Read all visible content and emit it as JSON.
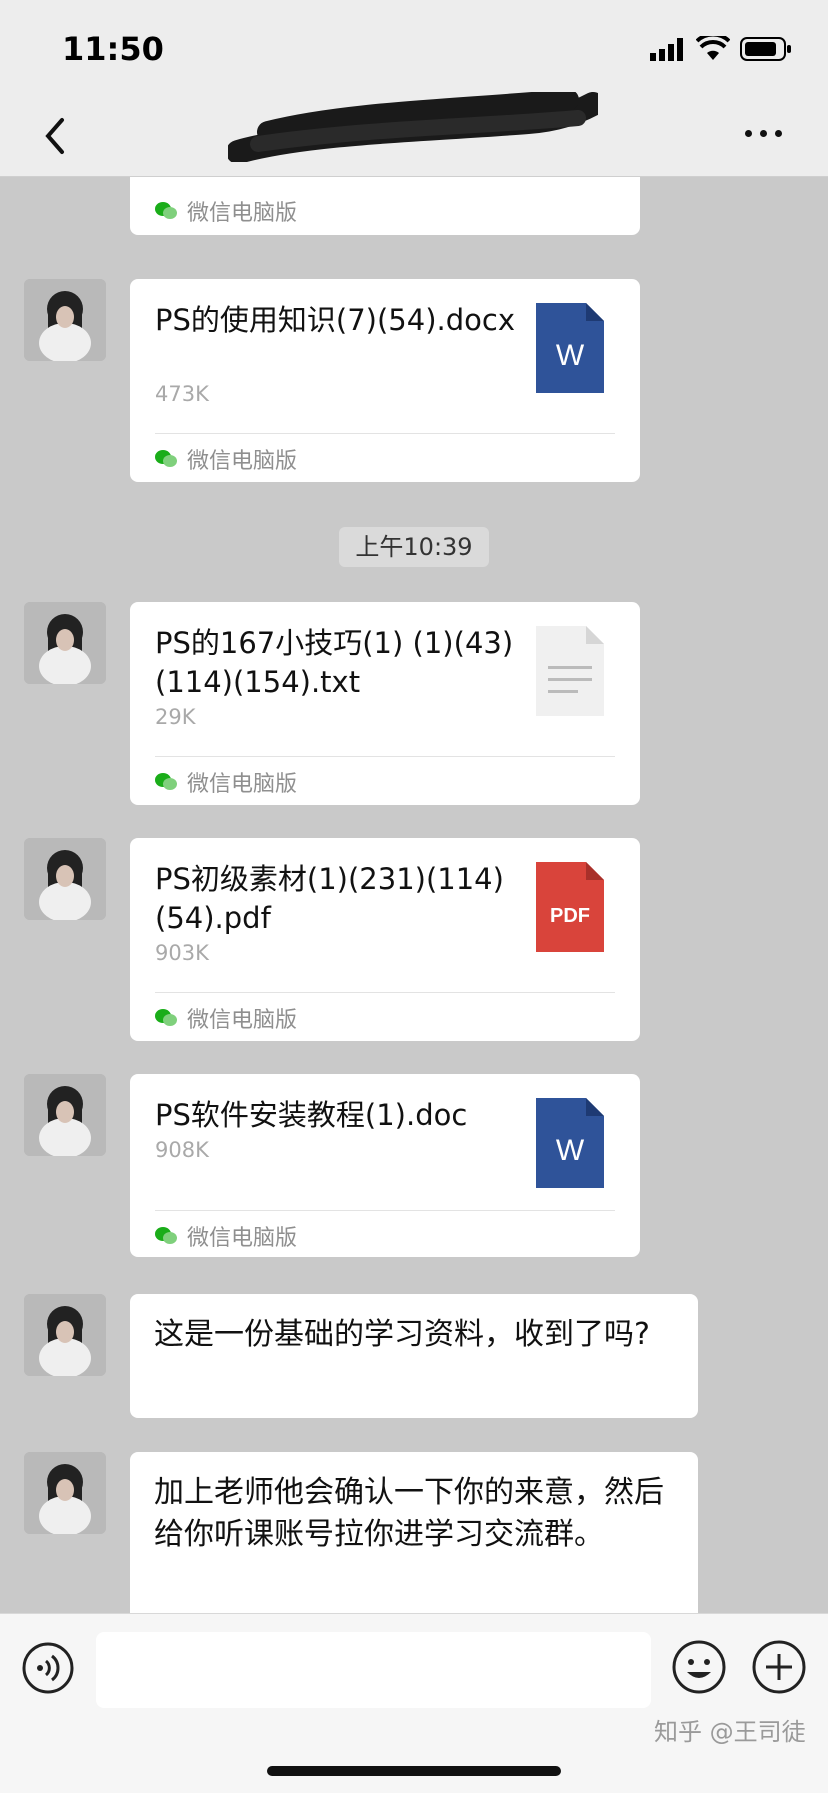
{
  "status_bar": {
    "time": "11:50"
  },
  "header": {
    "title": ""
  },
  "messages": [
    {
      "kind": "file_partial",
      "source": "微信电脑版"
    },
    {
      "kind": "file",
      "name": "PS的使用知识(7)(54).docx",
      "size": "473K",
      "file_type": "word",
      "icon_label": "W",
      "source": "微信电脑版"
    },
    {
      "kind": "timestamp",
      "text": "上午10:39"
    },
    {
      "kind": "file",
      "name": "PS的167小技巧(1) (1)(43)(114)(154).txt",
      "size": "29K",
      "file_type": "txt",
      "source": "微信电脑版"
    },
    {
      "kind": "file",
      "name": "PS初级素材(1)(231)(114)(54).pdf",
      "size": "903K",
      "file_type": "pdf",
      "icon_label": "PDF",
      "source": "微信电脑版"
    },
    {
      "kind": "file",
      "name": "PS软件安装教程(1).doc",
      "size": "908K",
      "file_type": "word",
      "icon_label": "W",
      "source": "微信电脑版"
    },
    {
      "kind": "text",
      "text": "这是一份基础的学习资料，收到了吗?"
    },
    {
      "kind": "text",
      "text": "加上老师他会确认一下你的来意，然后给你听课账号拉你进学习交流群。"
    }
  ],
  "input_bar": {
    "watermark": "知乎 @王司徒"
  },
  "colors": {
    "word": "#2f5399",
    "pdf": "#d9443b",
    "txt": "#f0f0f0",
    "chat_bg": "#c9c9c9",
    "bar_bg": "#ededed"
  }
}
